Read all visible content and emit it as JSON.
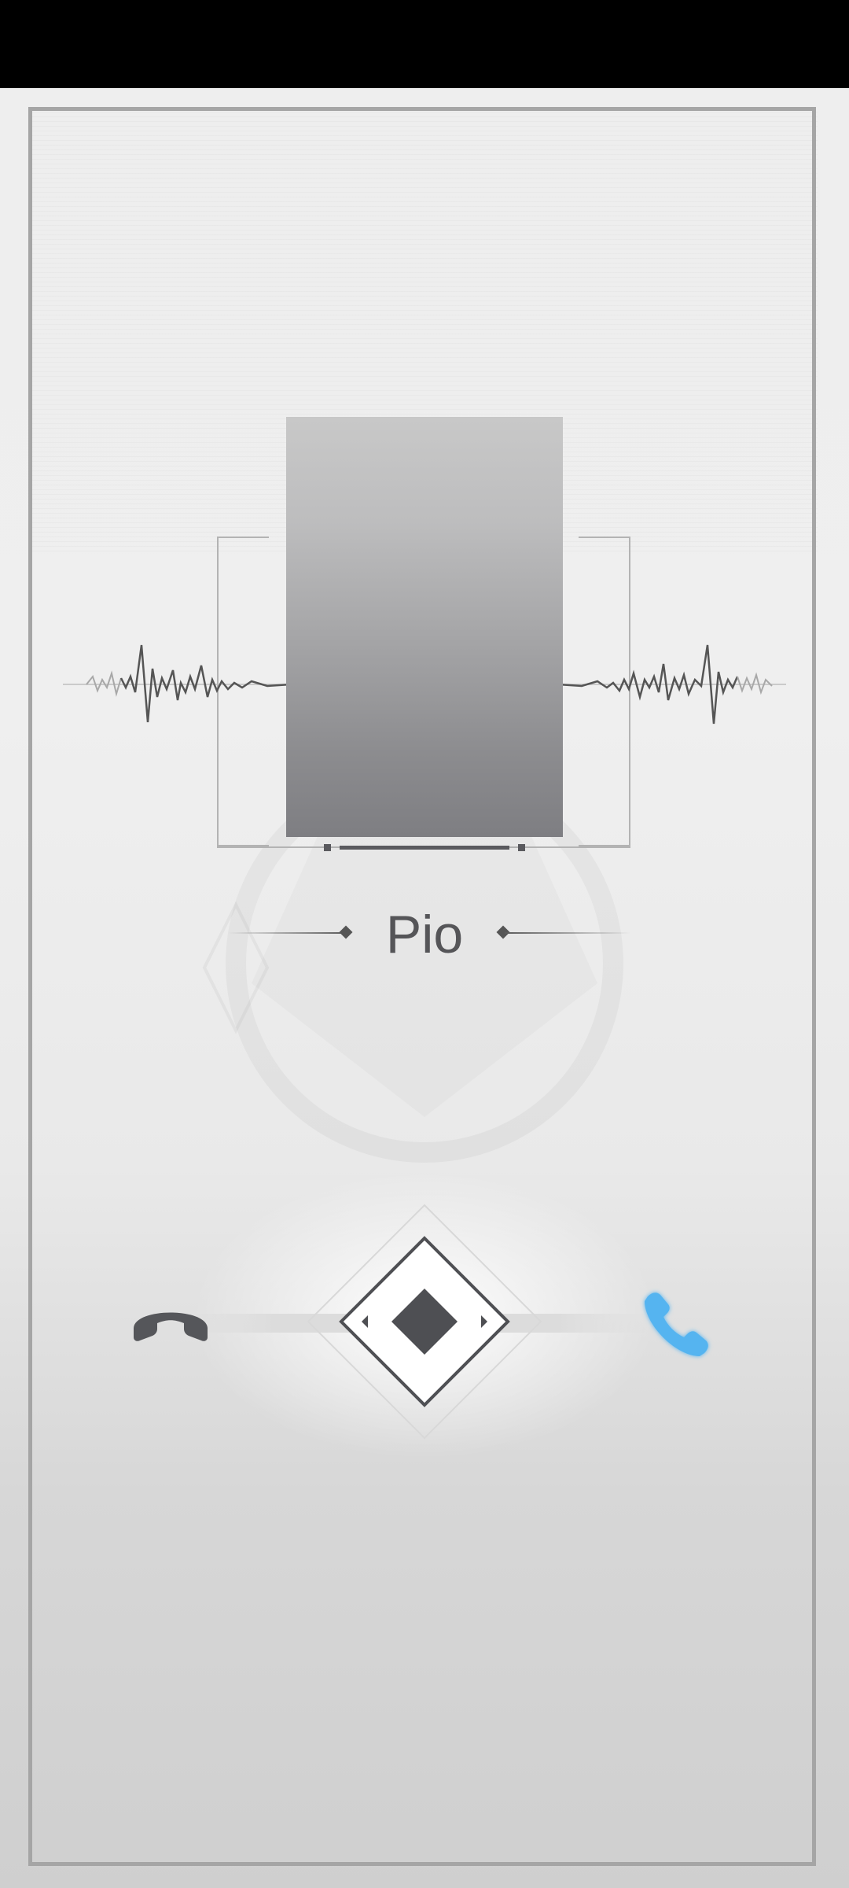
{
  "call": {
    "caller_name": "Pio"
  },
  "controls": {
    "decline_icon": "phone-hangup-icon",
    "accept_icon": "phone-answer-icon",
    "slider_icon": "diamond-slider-icon"
  },
  "colors": {
    "accent_accept": "#55b4f0",
    "decline_gray": "#55565a",
    "frame_gray": "#a5a5a5",
    "text_gray": "#555558"
  }
}
